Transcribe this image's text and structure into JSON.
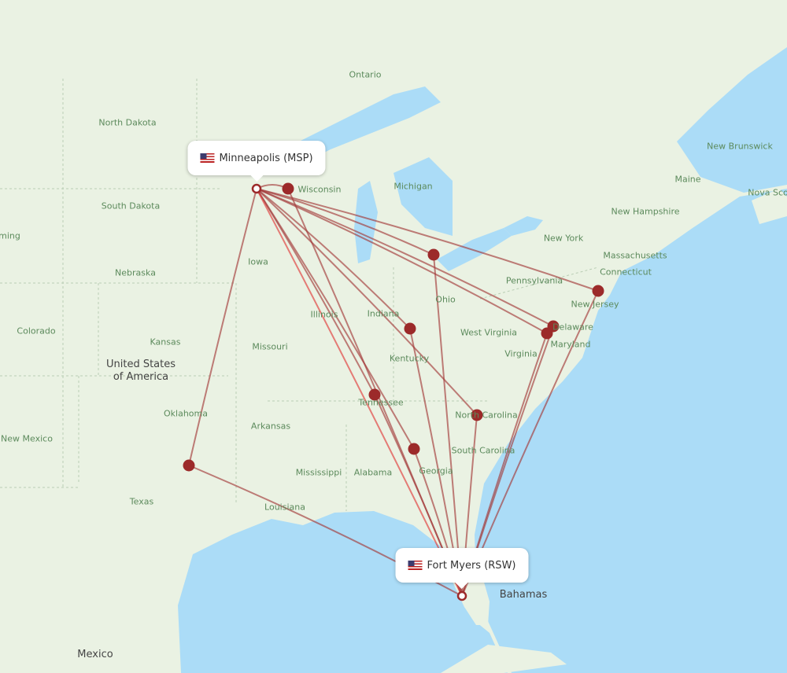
{
  "origin": {
    "label": "Minneapolis (MSP)",
    "flag": "us-flag-icon"
  },
  "destination": {
    "label": "Fort Myers (RSW)",
    "flag": "us-flag-icon"
  },
  "colors": {
    "land": "#eaf2e3",
    "water": "#abdcf7",
    "route": "#a33a3a",
    "marker": "#9c2a2a"
  },
  "labels": {
    "states": [
      "North Dakota",
      "South Dakota",
      "Nebraska",
      "Kansas",
      "Oklahoma",
      "Texas",
      "Colorado",
      "New Mexico",
      "ming",
      "Iowa",
      "Missouri",
      "Arkansas",
      "Louisiana",
      "Mississippi",
      "Alabama",
      "Georgia",
      "Tennessee",
      "Kentucky",
      "Illinois",
      "Indiana",
      "Ohio",
      "Michigan",
      "Wisconsin",
      "West Virginia",
      "Virginia",
      "North Carolina",
      "South Carolina",
      "Pennsylvania",
      "New York",
      "New Jersey",
      "Delaware",
      "Maryland",
      "Connecticut",
      "Massachusetts",
      "New Hampshire",
      "Maine",
      "New Brunswick",
      "Nova Sco",
      "Ontario"
    ],
    "countries": [
      "United States of America",
      "Mexico",
      "Bahamas"
    ]
  }
}
